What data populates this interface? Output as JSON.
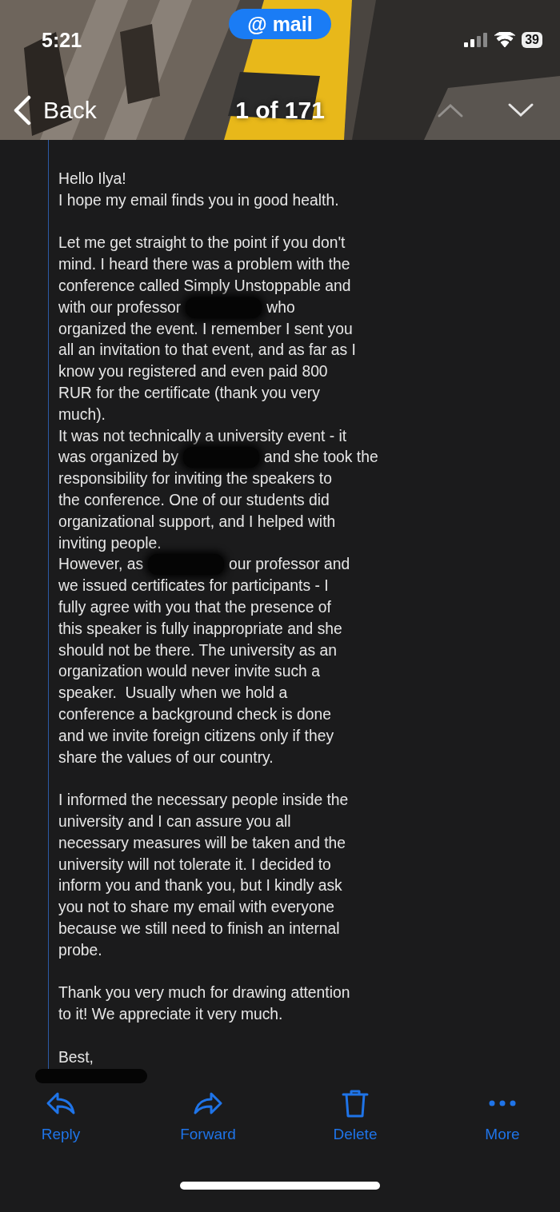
{
  "status_bar": {
    "time": "5:21",
    "app_pill": "@ mail",
    "battery": "39"
  },
  "nav": {
    "back": "Back",
    "position": "1 of 171",
    "prev": {
      "disabled": true
    },
    "next": {
      "disabled": false
    }
  },
  "body": [
    {
      "kind": "line",
      "text": "Hello Ilya!"
    },
    {
      "kind": "line",
      "text": "I hope my email finds you in good health."
    },
    {
      "kind": "gap"
    },
    {
      "kind": "line",
      "text": "Let me get straight to the point if you don't"
    },
    {
      "kind": "line",
      "text": "mind. I heard there was a problem with the"
    },
    {
      "kind": "line",
      "text": "conference called Simply Unstoppable and"
    },
    {
      "kind": "redacted",
      "before": "with our professor",
      "after": "who"
    },
    {
      "kind": "line",
      "text": "organized the event. I remember I sent you"
    },
    {
      "kind": "line",
      "text": "all an invitation to that event, and as far as I"
    },
    {
      "kind": "line",
      "text": "know you registered and even paid 800"
    },
    {
      "kind": "line",
      "text": "RUR for the certificate (thank you very"
    },
    {
      "kind": "line",
      "text": "much)."
    },
    {
      "kind": "line",
      "text": "It was not technically a university event - it"
    },
    {
      "kind": "redacted",
      "before": "was organized by",
      "after": "and she took the"
    },
    {
      "kind": "line",
      "text": "responsibility for inviting the speakers to"
    },
    {
      "kind": "line",
      "text": "the conference. One of our students did"
    },
    {
      "kind": "line",
      "text": "organizational support, and I helped with"
    },
    {
      "kind": "line",
      "text": "inviting people."
    },
    {
      "kind": "redacted",
      "before": "However, as",
      "after": "our professor and"
    },
    {
      "kind": "line",
      "text": "we issued certificates for participants - I"
    },
    {
      "kind": "line",
      "text": "fully agree with you that the presence of"
    },
    {
      "kind": "line",
      "text": "this speaker is fully inappropriate and she"
    },
    {
      "kind": "line",
      "text": "should not be there. The university as an"
    },
    {
      "kind": "line",
      "text": "organization would never invite such a"
    },
    {
      "kind": "line",
      "text": "speaker.  Usually when we hold a"
    },
    {
      "kind": "line",
      "text": "conference a background check is done"
    },
    {
      "kind": "line",
      "text": "and we invite foreign citizens only if they"
    },
    {
      "kind": "line",
      "text": "share the values of our country."
    },
    {
      "kind": "gap"
    },
    {
      "kind": "line",
      "text": "I informed the necessary people inside the"
    },
    {
      "kind": "line",
      "text": "university and I can assure you all"
    },
    {
      "kind": "line",
      "text": "necessary measures will be taken and the"
    },
    {
      "kind": "line",
      "text": "university will not tolerate it. I decided to"
    },
    {
      "kind": "line",
      "text": "inform you and thank you, but I kindly ask"
    },
    {
      "kind": "line",
      "text": "you not to share my email with everyone"
    },
    {
      "kind": "line",
      "text": "because we still need to finish an internal"
    },
    {
      "kind": "line",
      "text": "probe."
    },
    {
      "kind": "gap"
    },
    {
      "kind": "line",
      "text": "Thank you very much for drawing attention"
    },
    {
      "kind": "line",
      "text": "to it! We appreciate it very much."
    },
    {
      "kind": "gap"
    },
    {
      "kind": "line",
      "text": "Best,"
    }
  ],
  "toolbar": [
    {
      "kind": "reply",
      "label": "Reply"
    },
    {
      "kind": "forward",
      "label": "Forward"
    },
    {
      "kind": "delete",
      "label": "Delete"
    },
    {
      "kind": "more",
      "label": "More"
    }
  ]
}
